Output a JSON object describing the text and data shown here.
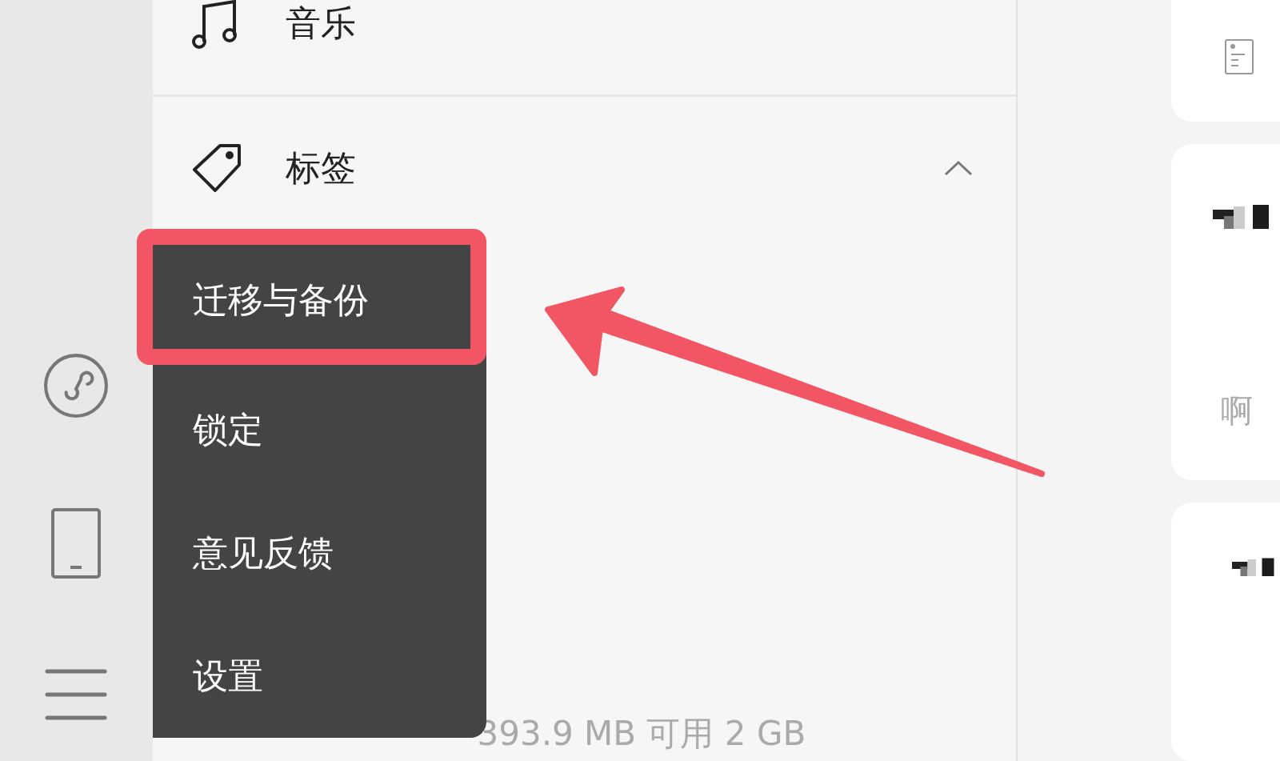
{
  "nav": [
    {
      "kind": "plain",
      "label": "音乐"
    },
    {
      "kind": "group",
      "label": "标签",
      "expanded": true
    }
  ],
  "menu": {
    "items": [
      {
        "label": "迁移与备份",
        "highlighted": true
      },
      {
        "label": "锁定",
        "highlighted": false
      },
      {
        "label": "意见反馈",
        "highlighted": false
      },
      {
        "label": "设置",
        "highlighted": false
      }
    ]
  },
  "storage": "393.9 MB 可用 2 GB",
  "cards": [
    {
      "kind": "note"
    },
    {
      "kind": "mosaic",
      "caption": "啊"
    },
    {
      "kind": "mosaic"
    }
  ]
}
